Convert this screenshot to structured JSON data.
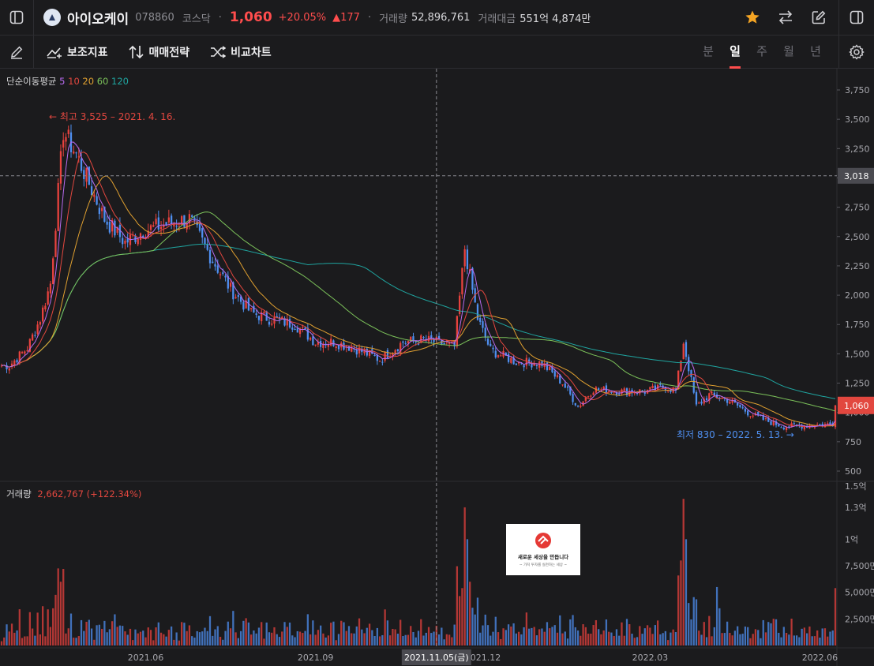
{
  "header": {
    "stock_name": "아이오케이",
    "stock_code": "078860",
    "market": "코스닥",
    "price": "1,060",
    "change_pct": "+20.05%",
    "change_abs": "▲177",
    "volume_label": "거래량",
    "volume_value": "52,896,761",
    "amount_label": "거래대금",
    "amount_value": "551억 4,874만"
  },
  "toolbar": {
    "indicators_label": "보조지표",
    "strategy_label": "매매전략",
    "compare_label": "비교차트",
    "periods": [
      "분",
      "일",
      "주",
      "월",
      "년"
    ],
    "active_period": "일"
  },
  "colors": {
    "up": "#e8423e",
    "down": "#4f8ff0",
    "ma5": "#b86bf0",
    "ma10": "#e2473f",
    "ma20": "#e0a030",
    "ma60": "#7cc25a",
    "ma120": "#1fa5a0"
  },
  "legend": {
    "ma_title": "단순이동평균",
    "ma_periods": [
      "5",
      "10",
      "20",
      "60",
      "120"
    ],
    "volume_title": "거래량",
    "volume_value": "2,662,767 (+122.34%)"
  },
  "annotations": {
    "high": "← 최고 3,525 – 2021. 4. 16.",
    "low": "최저 830 – 2022. 5. 13. →"
  },
  "price_axis": {
    "ticks": [
      "3,750",
      "3,500",
      "3,250",
      "3,000",
      "2,750",
      "2,500",
      "2,250",
      "2,000",
      "1,750",
      "1,500",
      "1,250",
      "1,000",
      "750",
      "500"
    ],
    "crosshair_label": "3,018",
    "current_label": "1,060"
  },
  "volume_axis": {
    "ticks": [
      "1.5억",
      "1.3억",
      "1억",
      "7,500만",
      "5,000만",
      "2,500만"
    ]
  },
  "date_axis": {
    "ticks": [
      "2021.06",
      "2021.09",
      "2021.12",
      "2022.03",
      "2022.06"
    ],
    "crosshair_label": "2021.11.05(금)"
  },
  "watermark": {
    "line1": "새로운 세상을 만듭니다",
    "line2": "~ 가치 투자를 실천하는 세상 ~"
  },
  "chart_data": {
    "type": "candlestick",
    "price_path_anchors": [
      [
        "2021-03-18",
        1400
      ],
      [
        "2021-03-29",
        1550
      ],
      [
        "2021-04-05",
        1800
      ],
      [
        "2021-04-10",
        2100
      ],
      [
        "2021-04-16",
        3400
      ],
      [
        "2021-04-23",
        3200
      ],
      [
        "2021-05-03",
        2900
      ],
      [
        "2021-05-10",
        2650
      ],
      [
        "2021-05-20",
        2450
      ],
      [
        "2021-05-31",
        2550
      ],
      [
        "2021-06-10",
        2600
      ],
      [
        "2021-06-24",
        2650
      ],
      [
        "2021-07-07",
        2300
      ],
      [
        "2021-07-17",
        2050
      ],
      [
        "2021-07-28",
        1850
      ],
      [
        "2021-08-06",
        1800
      ],
      [
        "2021-08-20",
        1750
      ],
      [
        "2021-09-01",
        1600
      ],
      [
        "2021-09-10",
        1600
      ],
      [
        "2021-09-22",
        1550
      ],
      [
        "2021-10-06",
        1450
      ],
      [
        "2021-10-19",
        1600
      ],
      [
        "2021-10-29",
        1620
      ],
      [
        "2021-11-05",
        1600
      ],
      [
        "2021-11-16",
        1560
      ],
      [
        "2021-11-22",
        2400
      ],
      [
        "2021-11-29",
        1800
      ],
      [
        "2021-12-06",
        1530
      ],
      [
        "2021-12-20",
        1430
      ],
      [
        "2022-01-03",
        1420
      ],
      [
        "2022-01-13",
        1250
      ],
      [
        "2022-01-21",
        1050
      ],
      [
        "2022-01-31",
        1200
      ],
      [
        "2022-02-14",
        1180
      ],
      [
        "2022-02-28",
        1180
      ],
      [
        "2022-03-10",
        1220
      ],
      [
        "2022-03-16",
        1180
      ],
      [
        "2022-03-21",
        1600
      ],
      [
        "2022-03-28",
        1050
      ],
      [
        "2022-04-04",
        1150
      ],
      [
        "2022-04-14",
        1100
      ],
      [
        "2022-04-25",
        1000
      ],
      [
        "2022-05-04",
        930
      ],
      [
        "2022-05-13",
        880
      ],
      [
        "2022-05-27",
        890
      ],
      [
        "2022-06-08",
        900
      ],
      [
        "2022-06-10",
        1060
      ]
    ],
    "price_ylim": [
      500,
      3750
    ],
    "volume_ylim": [
      0,
      150000000
    ]
  }
}
